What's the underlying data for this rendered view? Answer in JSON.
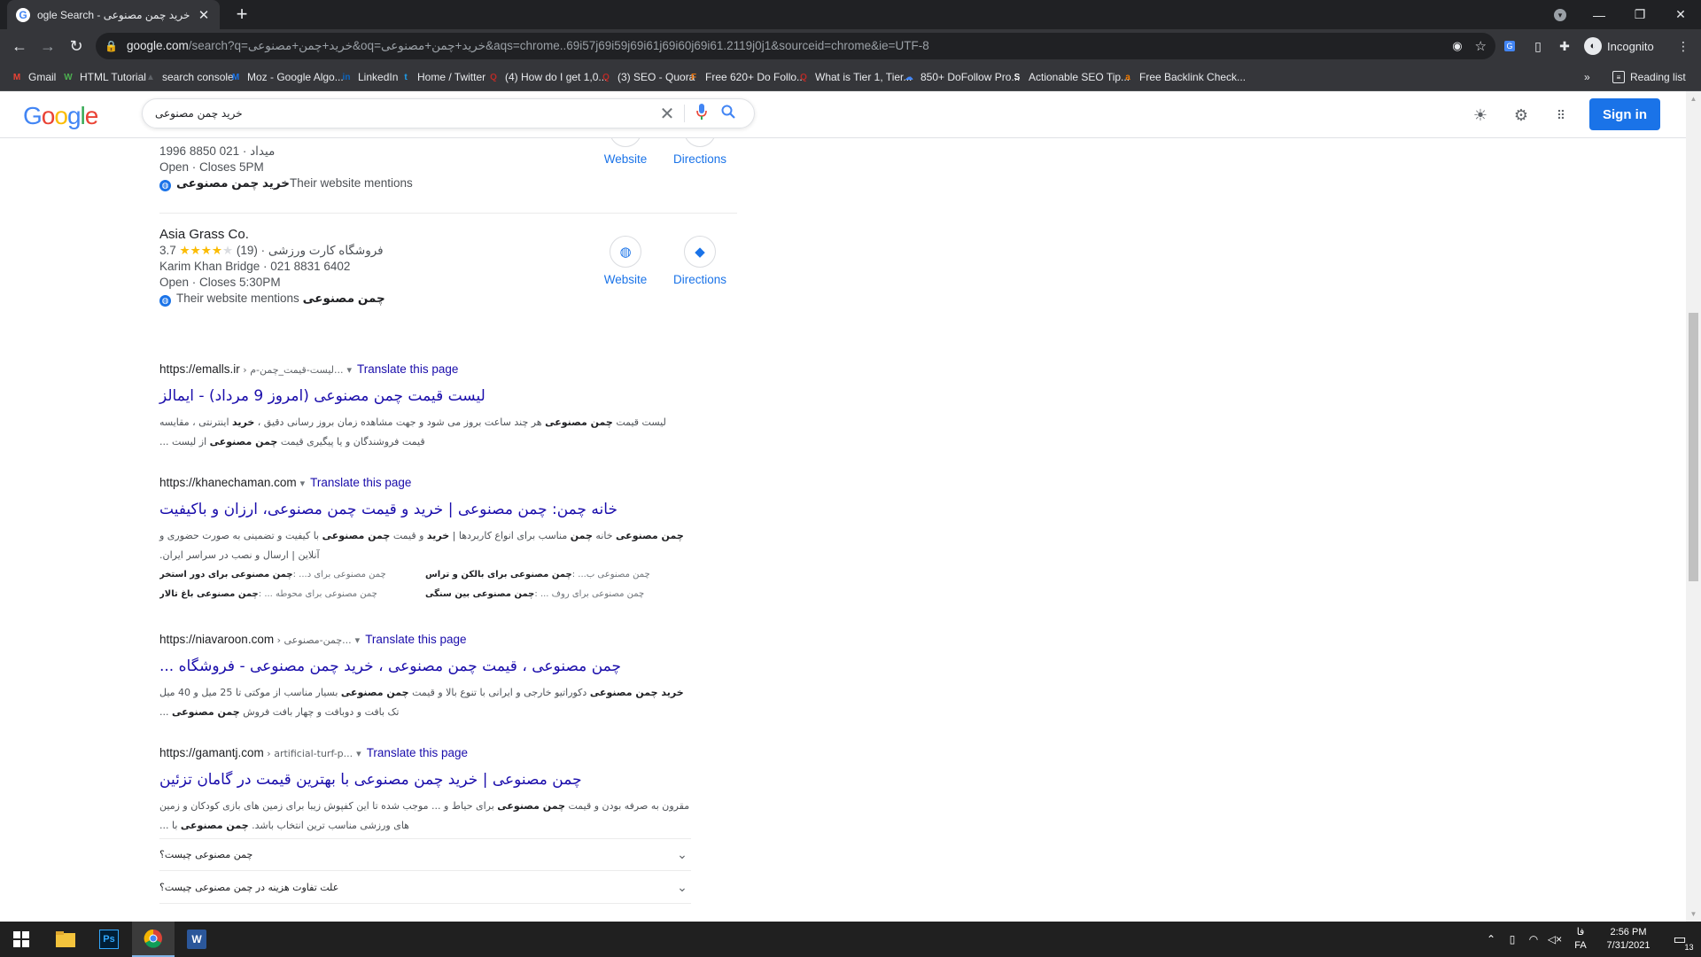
{
  "browser": {
    "tab_title": "ogle Search - خرید چمن مصنوعی",
    "tab_favicon": "G",
    "new_tab": "+",
    "url_host": "google.com",
    "url_rest": "/search?q=خرید+چمن+مصنوعی&oq=خرید+چمن+مصنوعی&aqs=chrome..69i57j69i59j69i61j69i60j69i61.2119j0j1&sourceid=chrome&ie=UTF-8",
    "profile": "Incognito"
  },
  "bookmarks": [
    {
      "label": "Gmail",
      "icon": "gmail-icon",
      "color": "#ea4335",
      "glyph": "M"
    },
    {
      "label": "HTML Tutorial",
      "icon": "w3schools-icon",
      "color": "#4caf50",
      "glyph": "W"
    },
    {
      "label": "search console",
      "icon": "search-console-icon",
      "color": "#5f6368",
      "glyph": "▲"
    },
    {
      "label": "Moz - Google Algo...",
      "icon": "moz-icon",
      "color": "#1a73e8",
      "glyph": "M"
    },
    {
      "label": "LinkedIn",
      "icon": "linkedin-icon",
      "color": "#0a66c2",
      "glyph": "in"
    },
    {
      "label": "Home / Twitter",
      "icon": "twitter-icon",
      "color": "#1da1f2",
      "glyph": "t"
    },
    {
      "label": "(4) How do I get 1,0...",
      "icon": "quora-icon",
      "color": "#b92b27",
      "glyph": "Q"
    },
    {
      "label": "(3) SEO - Quora",
      "icon": "quora-icon",
      "color": "#b92b27",
      "glyph": "Q"
    },
    {
      "label": "Free 620+ Do Follo...",
      "icon": "site-icon",
      "color": "#e8710a",
      "glyph": "F"
    },
    {
      "label": "What is Tier 1, Tier...",
      "icon": "quora-icon",
      "color": "#b92b27",
      "glyph": "Q"
    },
    {
      "label": "850+ DoFollow Pro...",
      "icon": "cloud-icon",
      "color": "#4285f4",
      "glyph": "☁"
    },
    {
      "label": "Actionable SEO Tip...",
      "icon": "seo-icon",
      "color": "#ffffff",
      "glyph": "S"
    },
    {
      "label": "Free Backlink Check...",
      "icon": "ahrefs-icon",
      "color": "#f57c00",
      "glyph": "a"
    }
  ],
  "bookmarks_more": "»",
  "reading_list": "Reading list",
  "google": {
    "logo": [
      "G",
      "o",
      "o",
      "g",
      "l",
      "e"
    ],
    "query": "خرید چمن مصنوعی",
    "sign_in": "Sign in"
  },
  "local": [
    {
      "name": "",
      "rating": "",
      "line2": "میداد · 021 8850 1996",
      "hours": "Open · Closes 5PM",
      "mention_bold": "خرید چمن مصنوعی",
      "mention_text": "Their website mentions"
    },
    {
      "name": "Asia Grass Co.",
      "rating": "3.7",
      "stars": "★★★★",
      "stars_empty": "★",
      "reviews": "(19) · فروشگاه کارت ورزشی",
      "line2": "Karim Khan Bridge · 021 8831 6402",
      "hours": "Open · Closes 5:30PM",
      "mention_text": "Their website mentions",
      "mention_bold": "چمن مصنوعی"
    }
  ],
  "actions": {
    "website": "Website",
    "directions": "Directions"
  },
  "results": [
    {
      "cite": "https://emalls.ir",
      "path": " › لیست-قیمت_چمن-م...",
      "translate": "Translate this page",
      "title": "لیست قیمت چمن مصنوعی (امروز 9 مرداد) - ایمالز",
      "snippet_html": "لیست قیمت <b>چمن مصنوعی</b> هر چند ساعت بروز می شود و جهت مشاهده زمان بروز رسانی دقیق ، <b>خرید</b> اینترنتی ، مقایسه قیمت فروشندگان و یا پیگیری قیمت <b>چمن مصنوعی</b> از لیست ..."
    },
    {
      "cite": "https://khanechaman.com",
      "path": "",
      "translate": "Translate this page",
      "title": "خانه چمن: چمن مصنوعی | خرید و قیمت چمن مصنوعی، ارزان و باکیفیت",
      "snippet_html": "<b>چمن مصنوعی</b> خانه <b>چمن</b> مناسب برای انواع کاربردها | <b>خرید</b> و قیمت <b>چمن مصنوعی</b> با کیفیت و تضمینی به صورت حضوری و آنلاین | ارسال و نصب در سراسر ایران.",
      "sitelinks": [
        [
          "چمن مصنوعی برای د... :<b>چمن مصنوعی برای دور استخر</b>",
          "چمن مصنوعی ب... :<b>چمن مصنوعی برای بالکن و تراس</b>"
        ],
        [
          "چمن مصنوعی برای محوطه ... :<b>چمن مصنوعی باغ تالار</b>",
          "چمن مصنوعی برای روف ... :<b>چمن مصنوعی بین سنگی</b>"
        ]
      ]
    },
    {
      "cite": "https://niavaroon.com",
      "path": " › چمن-مصنوعی...",
      "translate": "Translate this page",
      "title": "چمن مصنوعی ، قیمت چمن مصنوعی ، خرید چمن مصنوعی - فروشگاه ...",
      "snippet_html": "<b>خرید چمن مصنوعی</b> دکوراتیو خارجی و ایرانی با تنوع بالا و قیمت <b>چمن مصنوعی</b> بسیار مناسب از موکتی تا 25 میل و 40 میل تک بافت و دوبافت و چهار بافت فروش <b>چمن مصنوعی</b> ..."
    },
    {
      "cite": "https://gamantj.com",
      "path": " › artificial-turf-p...",
      "translate": "Translate this page",
      "title": "چمن مصنوعی | خرید چمن مصنوعی با بهترین قیمت در گامان تزئین",
      "snippet_html": "مقرون به صرفه بودن و قیمت <b>چمن مصنوعی</b> برای حیاط و ... موجب شده تا این کفپوش زیبا برای زمین های بازی کودکان و زمین های ورزشی مناسب ترین انتخاب باشد. <b>چمن مصنوعی</b> با ..."
    }
  ],
  "faq": [
    "چمن مصنوعی چیست؟",
    "علت تفاوت هزینه در چمن مصنوعی چیست؟"
  ],
  "taskbar": {
    "time": "2:56 PM",
    "date": "7/31/2021",
    "lang_top": "فا",
    "lang": "FA",
    "notifications": "13"
  }
}
